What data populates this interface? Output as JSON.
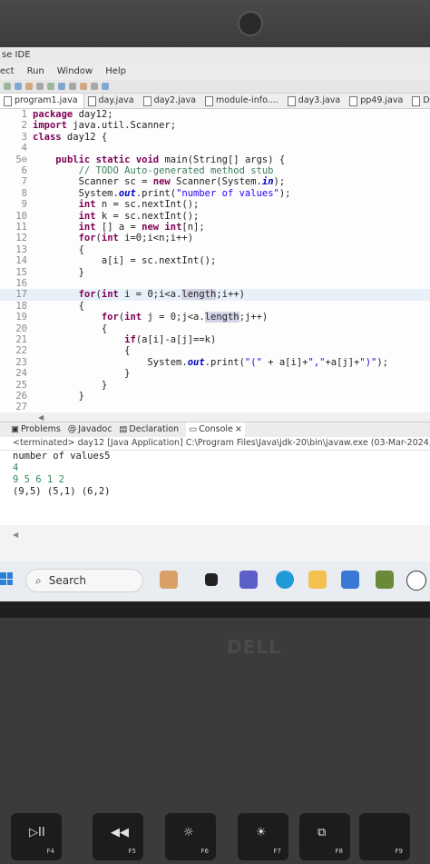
{
  "window": {
    "title": "se IDE"
  },
  "menu": [
    "ect",
    "Run",
    "Window",
    "Help"
  ],
  "tabs": [
    {
      "label": "program1.java",
      "active": true
    },
    {
      "label": "day.java"
    },
    {
      "label": "day2.java"
    },
    {
      "label": "module-info...."
    },
    {
      "label": "day3.java"
    },
    {
      "label": "pp49.java"
    },
    {
      "label": "D"
    }
  ],
  "code_lines": [
    {
      "n": "1",
      "text": "package day12;"
    },
    {
      "n": "2",
      "text": "import java.util.Scanner;"
    },
    {
      "n": "3",
      "text": "class day12 {"
    },
    {
      "n": "4",
      "text": ""
    },
    {
      "n": "5⊖",
      "text": "    public static void main(String[] args) {"
    },
    {
      "n": "6",
      "text": "        // TODO Auto-generated method stub"
    },
    {
      "n": "7",
      "text": "        Scanner sc = new Scanner(System.in);"
    },
    {
      "n": "8",
      "text": "        System.out.print(\"number of values\");"
    },
    {
      "n": "9",
      "text": "        int n = sc.nextInt();"
    },
    {
      "n": "10",
      "text": "        int k = sc.nextInt();"
    },
    {
      "n": "11",
      "text": "        int [] a = new int[n];"
    },
    {
      "n": "12",
      "text": "        for(int i=0;i<n;i++)"
    },
    {
      "n": "13",
      "text": "        {"
    },
    {
      "n": "14",
      "text": "            a[i] = sc.nextInt();"
    },
    {
      "n": "15",
      "text": "        }"
    },
    {
      "n": "16",
      "text": ""
    },
    {
      "n": "17",
      "text": "        for(int i = 0;i<a.length;i++)"
    },
    {
      "n": "18",
      "text": "        {"
    },
    {
      "n": "19",
      "text": "            for(int j = 0;j<a.length;j++)"
    },
    {
      "n": "20",
      "text": "            {"
    },
    {
      "n": "21",
      "text": "                if(a[i]-a[j]==k)"
    },
    {
      "n": "22",
      "text": "                {"
    },
    {
      "n": "23",
      "text": "                    System.out.print(\"(\" + a[i]+\",\"+a[j]+\")\");"
    },
    {
      "n": "24",
      "text": "                }"
    },
    {
      "n": "25",
      "text": "            }"
    },
    {
      "n": "26",
      "text": "        }"
    },
    {
      "n": "27",
      "text": ""
    }
  ],
  "panel": {
    "tabs": [
      "Problems",
      "Javadoc",
      "Declaration",
      "Console"
    ],
    "active_tab": "Console",
    "status": "<terminated> day12 [Java Application] C:\\Program Files\\Java\\jdk-20\\bin\\javaw.exe  (03-Mar-2024, 10:2",
    "output": [
      "number of values5",
      "4",
      "9 5 6 1 2",
      "(9,5) (5,1) (6,2)"
    ]
  },
  "taskbar": {
    "search_placeholder": "Search"
  },
  "laptop": {
    "brand": "DELL",
    "keys": [
      {
        "sym": "▷II",
        "label": "F4"
      },
      {
        "sym": "◀◀",
        "label": "F5"
      },
      {
        "sym": "☼",
        "label": "F6"
      },
      {
        "sym": "☀",
        "label": "F7"
      },
      {
        "sym": "⧉",
        "label": "F8"
      },
      {
        "sym": "",
        "label": "F9"
      }
    ]
  }
}
